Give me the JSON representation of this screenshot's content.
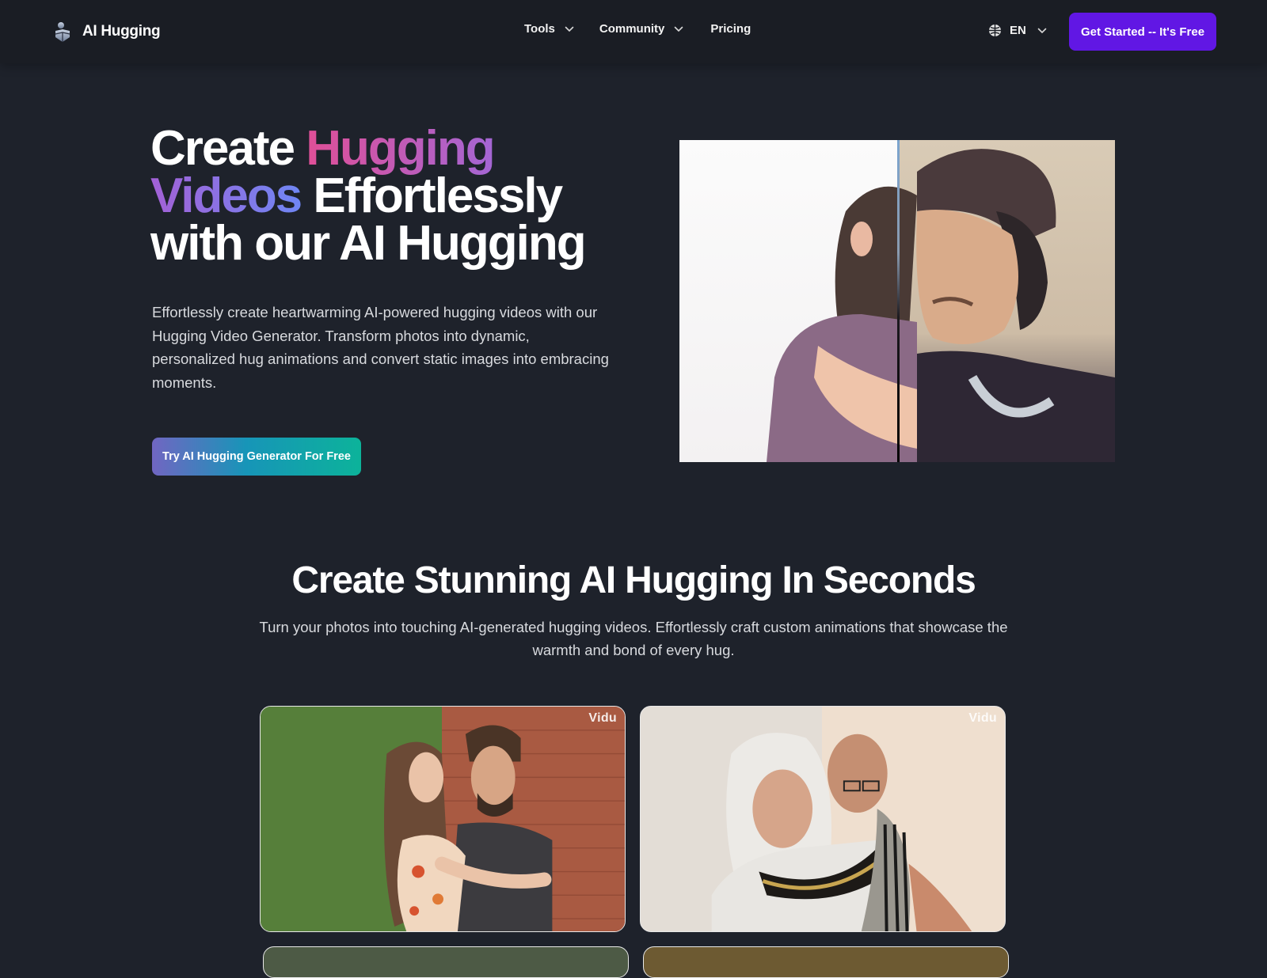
{
  "nav": {
    "brand": "AI Hugging",
    "brand_icon": "hug-logo-icon",
    "links": [
      {
        "label": "Tools",
        "has_dropdown": true
      },
      {
        "label": "Community",
        "has_dropdown": true
      },
      {
        "label": "Pricing",
        "has_dropdown": false
      }
    ],
    "language": {
      "icon": "globe-icon",
      "label": "EN"
    },
    "cta_label": "Get Started -- It's Free"
  },
  "hero": {
    "title_parts": {
      "p1": "Create ",
      "p2": "Hugging",
      "p3": "Videos",
      "p4": " Effortlessly",
      "p5": "with our AI Hugging"
    },
    "description": "Effortlessly create heartwarming AI-powered hugging videos with our Hugging Video Generator. Transform photos into dynamic, personalized hug animations and convert static images into embracing moments.",
    "cta_label": "Try AI Hugging Generator For Free",
    "media_alt": "Before/after comparison of a girl hugging a man"
  },
  "showcase": {
    "title": "Create Stunning AI Hugging In Seconds",
    "description": "Turn your photos into touching AI-generated hugging videos. Effortlessly craft custom animations that showcase the warmth and bond of every hug.",
    "cards": [
      {
        "watermark": "Vidu",
        "alt": "Couple hugging by a brick wall"
      },
      {
        "watermark": "Vidu",
        "alt": "Elderly couple embracing"
      },
      {
        "watermark": "",
        "alt": "Hugging video example 3"
      },
      {
        "watermark": "",
        "alt": "Hugging video example 4"
      }
    ]
  },
  "colors": {
    "background": "#1e222b",
    "nav_background": "#1a1d24",
    "primary_cta": "#6117e4",
    "gradient_pink": "#e04f97",
    "gradient_purple": "#a466d4",
    "gradient_blue": "#6f86f4",
    "hero_cta_start": "#7166c2",
    "hero_cta_end": "#0cb39a"
  }
}
